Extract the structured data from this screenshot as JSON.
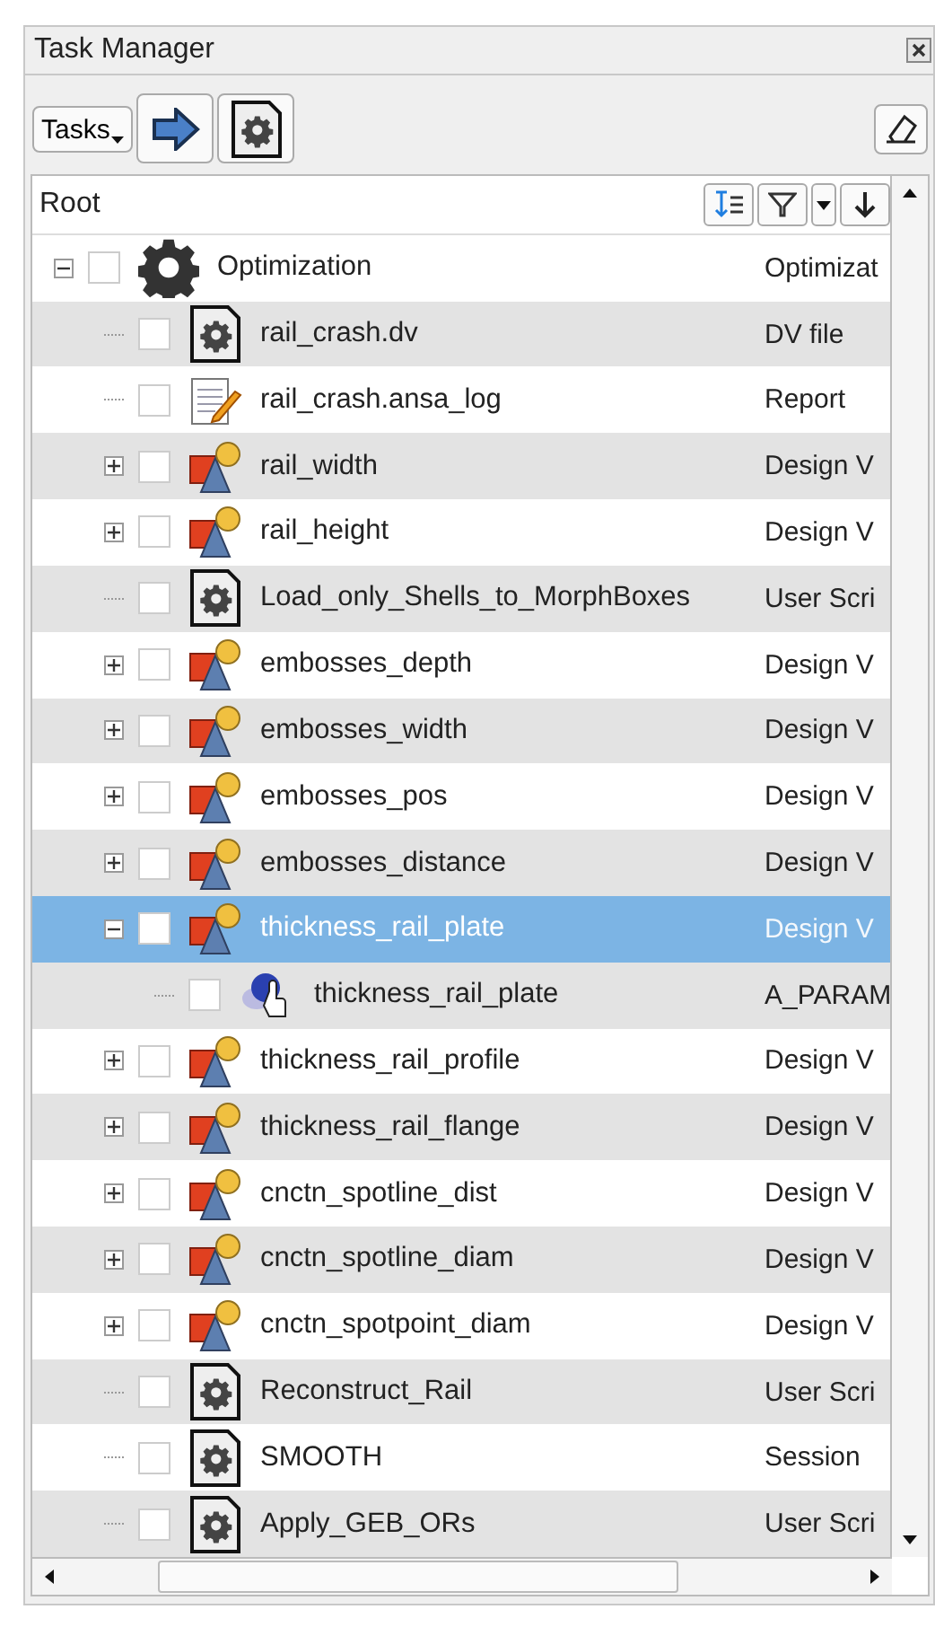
{
  "window": {
    "title": "Task Manager"
  },
  "toolbar": {
    "menu_label": "Tasks"
  },
  "tree": {
    "header": "Root",
    "rows": [
      {
        "name": "Optimization",
        "type": "Optimizat",
        "kind": "optimization",
        "checked": false,
        "selected": false,
        "expanded": true,
        "children": [
          {
            "name": "rail_crash.dv",
            "type": "DV file",
            "kind": "script",
            "checked": false,
            "selected": false
          },
          {
            "name": "rail_crash.ansa_log",
            "type": "Report",
            "kind": "log",
            "checked": false,
            "selected": false
          },
          {
            "name": "rail_width",
            "type": "Design V",
            "kind": "variable",
            "checked": false,
            "selected": false,
            "expanded": false
          },
          {
            "name": "rail_height",
            "type": "Design V",
            "kind": "variable",
            "checked": false,
            "selected": false,
            "expanded": false
          },
          {
            "name": "Load_only_Shells_to_MorphBoxes",
            "type": "User Scri",
            "kind": "script",
            "checked": false,
            "selected": false
          },
          {
            "name": "embosses_depth",
            "type": "Design V",
            "kind": "variable",
            "checked": false,
            "selected": false,
            "expanded": false
          },
          {
            "name": "embosses_width",
            "type": "Design V",
            "kind": "variable",
            "checked": false,
            "selected": false,
            "expanded": false
          },
          {
            "name": "embosses_pos",
            "type": "Design V",
            "kind": "variable",
            "checked": false,
            "selected": false,
            "expanded": false
          },
          {
            "name": "embosses_distance",
            "type": "Design V",
            "kind": "variable",
            "checked": false,
            "selected": false,
            "expanded": false
          },
          {
            "name": "thickness_rail_plate",
            "type": "Design V",
            "kind": "variable",
            "checked": false,
            "selected": true,
            "expanded": true,
            "children": [
              {
                "name": "thickness_rail_plate",
                "type": "A_PARAM",
                "kind": "parameter",
                "checked": false,
                "selected": false
              }
            ]
          },
          {
            "name": "thickness_rail_profile",
            "type": "Design V",
            "kind": "variable",
            "checked": false,
            "selected": false,
            "expanded": false
          },
          {
            "name": "thickness_rail_flange",
            "type": "Design V",
            "kind": "variable",
            "checked": false,
            "selected": false,
            "expanded": false
          },
          {
            "name": "cnctn_spotline_dist",
            "type": "Design V",
            "kind": "variable",
            "checked": false,
            "selected": false,
            "expanded": false
          },
          {
            "name": "cnctn_spotline_diam",
            "type": "Design V",
            "kind": "variable",
            "checked": false,
            "selected": false,
            "expanded": false
          },
          {
            "name": "cnctn_spotpoint_diam",
            "type": "Design V",
            "kind": "variable",
            "checked": false,
            "selected": false,
            "expanded": false
          },
          {
            "name": "Reconstruct_Rail",
            "type": "User Scri",
            "kind": "script",
            "checked": false,
            "selected": false
          },
          {
            "name": "SMOOTH",
            "type": "Session",
            "kind": "script",
            "checked": false,
            "selected": false
          },
          {
            "name": "Apply_GEB_ORs",
            "type": "User Scri",
            "kind": "script",
            "checked": false,
            "selected": false
          }
        ]
      }
    ]
  }
}
